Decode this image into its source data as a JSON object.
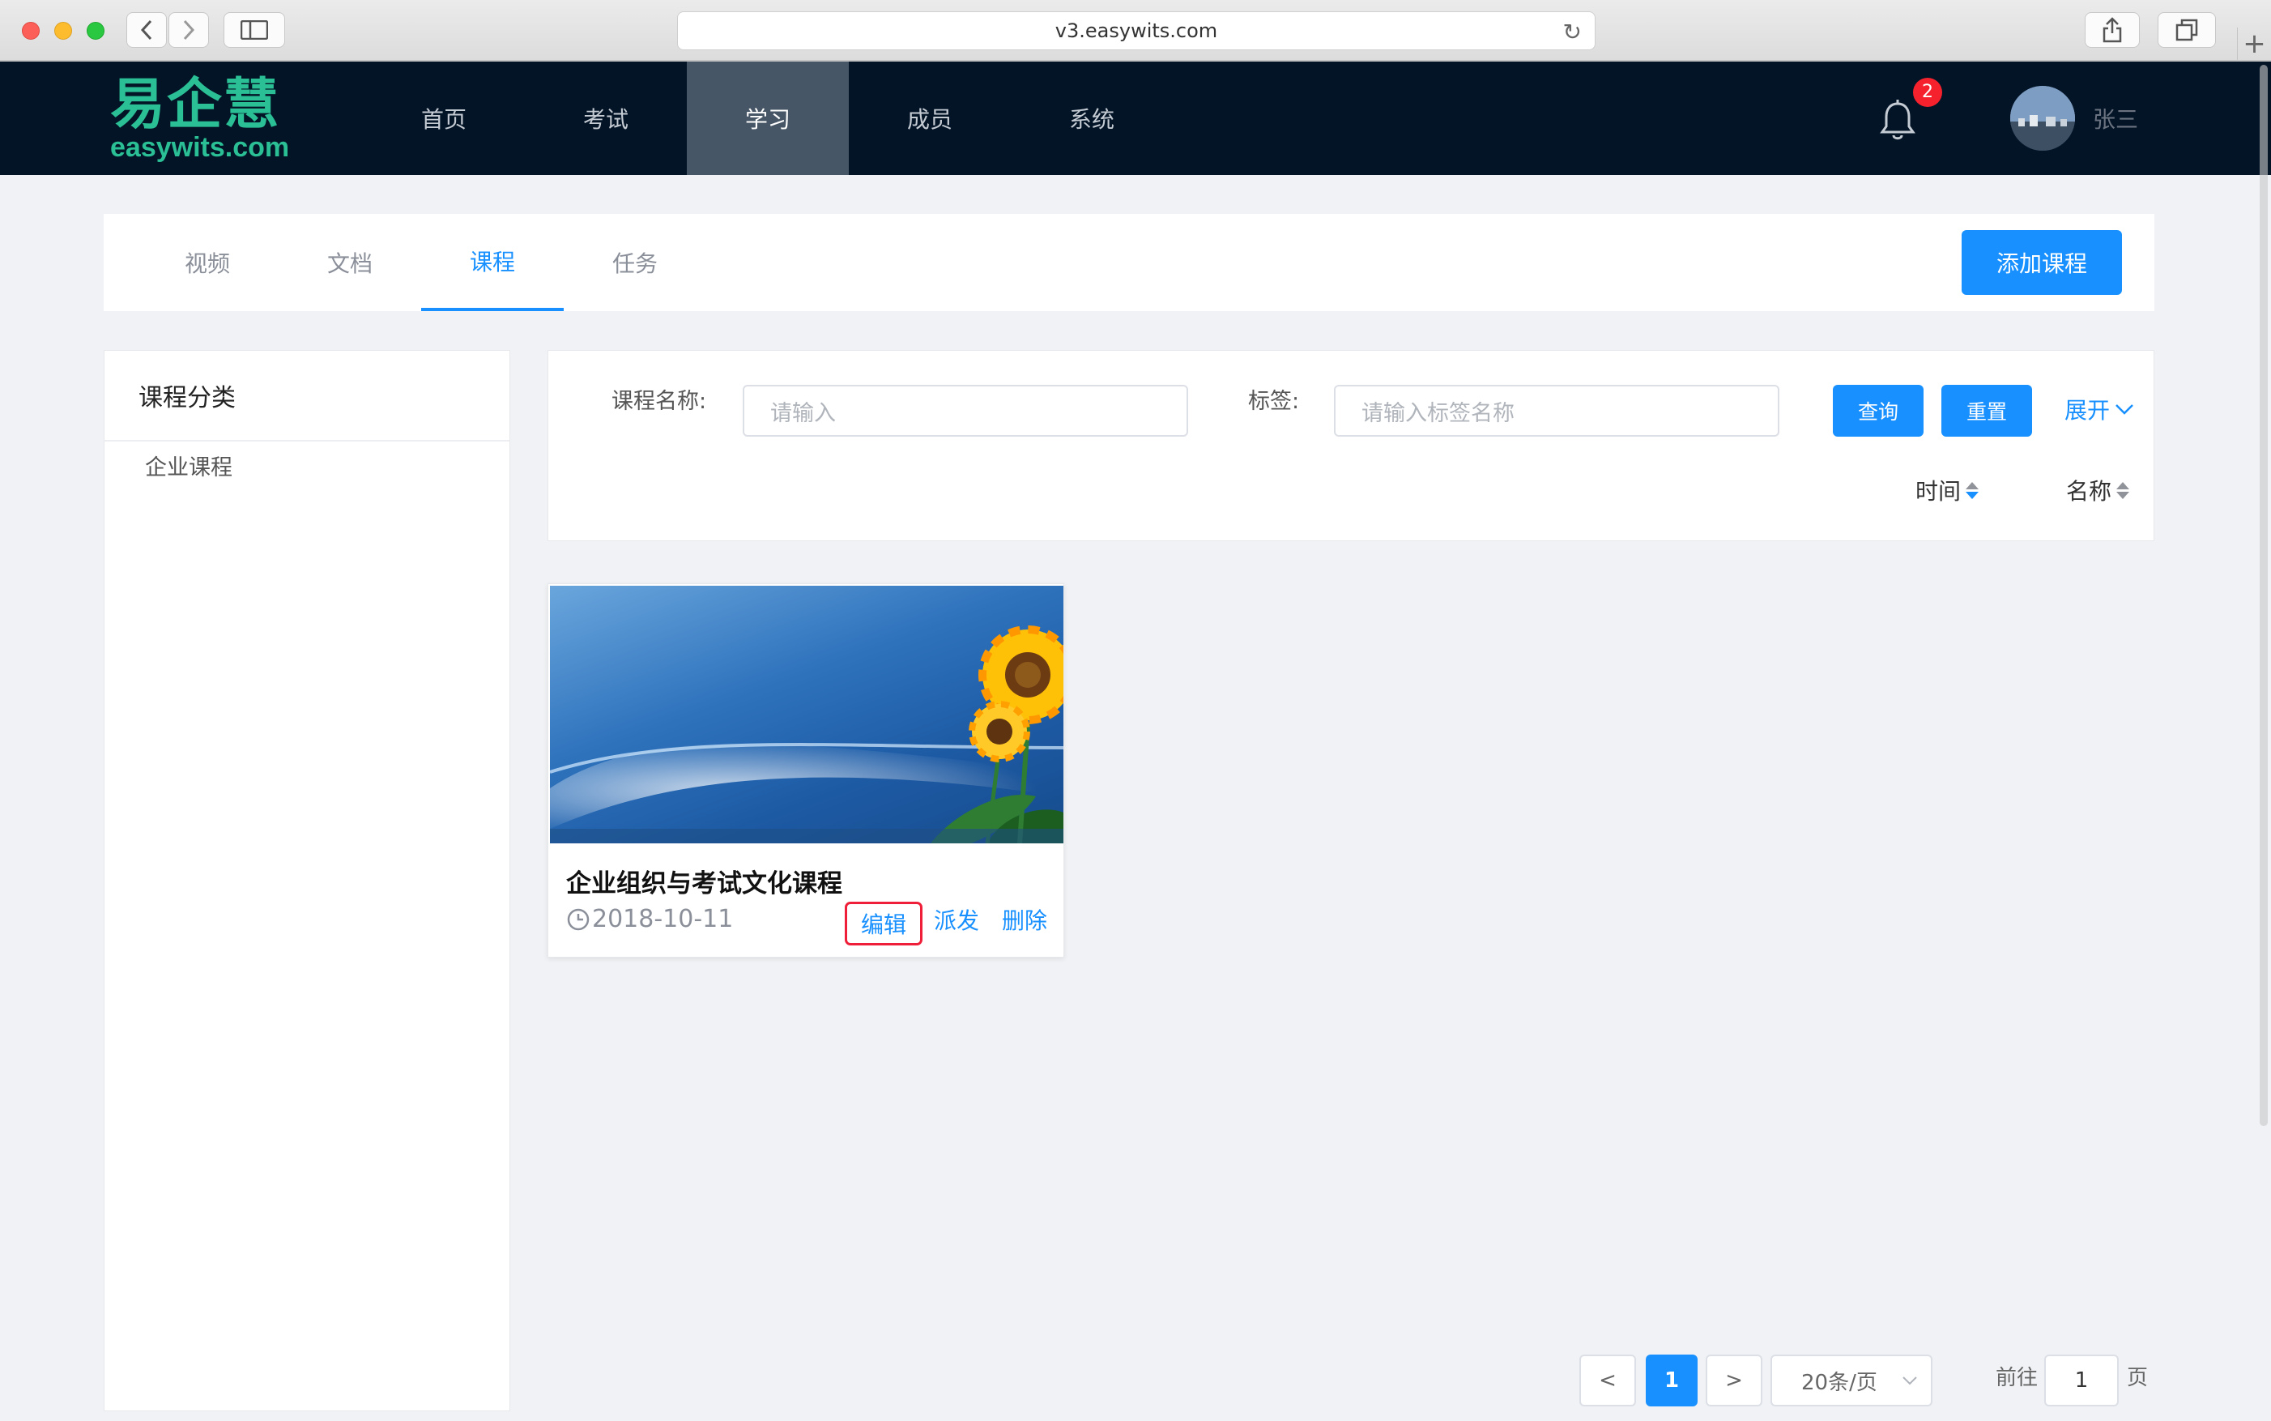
{
  "browser": {
    "url": "v3.easywits.com"
  },
  "header": {
    "logo_cn": "易企慧",
    "logo_en": "easywits.com",
    "nav": [
      {
        "label": "首页"
      },
      {
        "label": "考试"
      },
      {
        "label": "学习",
        "active": true
      },
      {
        "label": "成员"
      },
      {
        "label": "系统"
      }
    ],
    "notification_count": "2",
    "username": "张三"
  },
  "tabs": {
    "items": [
      {
        "label": "视频"
      },
      {
        "label": "文档"
      },
      {
        "label": "课程",
        "active": true
      },
      {
        "label": "任务"
      }
    ],
    "add_button": "添加课程"
  },
  "sidebar": {
    "title": "课程分类",
    "items": [
      {
        "label": "企业课程"
      }
    ]
  },
  "filter": {
    "name_label": "课程名称:",
    "name_placeholder": "请输入",
    "tag_label": "标签:",
    "tag_placeholder": "请输入标签名称",
    "query_button": "查询",
    "reset_button": "重置",
    "expand_label": "展开",
    "sort_time": "时间",
    "sort_name": "名称"
  },
  "courses": [
    {
      "title": "企业组织与考试文化课程",
      "date": "2018-10-11",
      "actions": {
        "edit": "编辑",
        "dispatch": "派发",
        "delete": "删除"
      }
    }
  ],
  "pagination": {
    "prev": "<",
    "current_page": "1",
    "next": ">",
    "page_size": "20条/页",
    "goto_label": "前往",
    "goto_value": "1",
    "page_suffix": "页"
  },
  "colors": {
    "primary": "#1890ff",
    "header_bg": "#031427",
    "nav_active_bg": "#475666",
    "logo": "#2bbf95",
    "highlight": "#ef1f3a"
  }
}
